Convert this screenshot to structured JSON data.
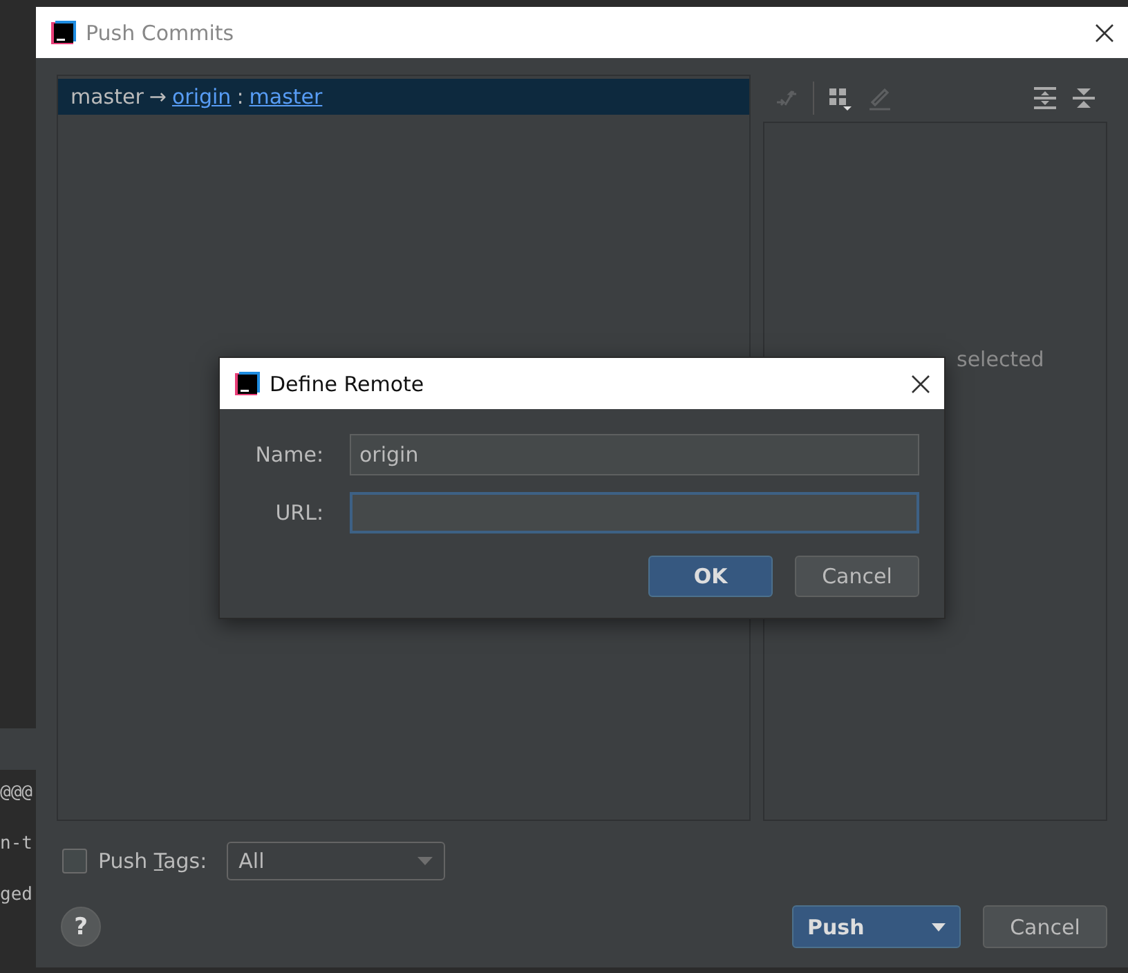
{
  "background_editor": {
    "lines": [
      "@@@",
      "n-t",
      "ged"
    ]
  },
  "window": {
    "title": "Push Commits"
  },
  "branch_row": {
    "local": "master",
    "arrow": "→",
    "remote": "origin",
    "separator": ":",
    "remote_branch": "master",
    "selected": true
  },
  "details_panel": {
    "empty_text": "selected"
  },
  "push_tags": {
    "label": "Push ",
    "label_mnemonic": "T",
    "label_rest": "ags:",
    "checked": false,
    "value": "All"
  },
  "help_button": {
    "label": "?"
  },
  "buttons": [
    {
      "label": "Push",
      "kind": "split",
      "default": true
    },
    {
      "label": "Cancel",
      "kind": "plain",
      "default": false
    }
  ],
  "dialog": {
    "title": "Define Remote",
    "fields": [
      {
        "label": "Name:",
        "value": "origin",
        "focused": false
      },
      {
        "label": "URL:",
        "focused": true
      }
    ],
    "buttons": [
      {
        "label": "OK",
        "default": true
      },
      {
        "label": "Cancel",
        "default": false
      }
    ]
  }
}
